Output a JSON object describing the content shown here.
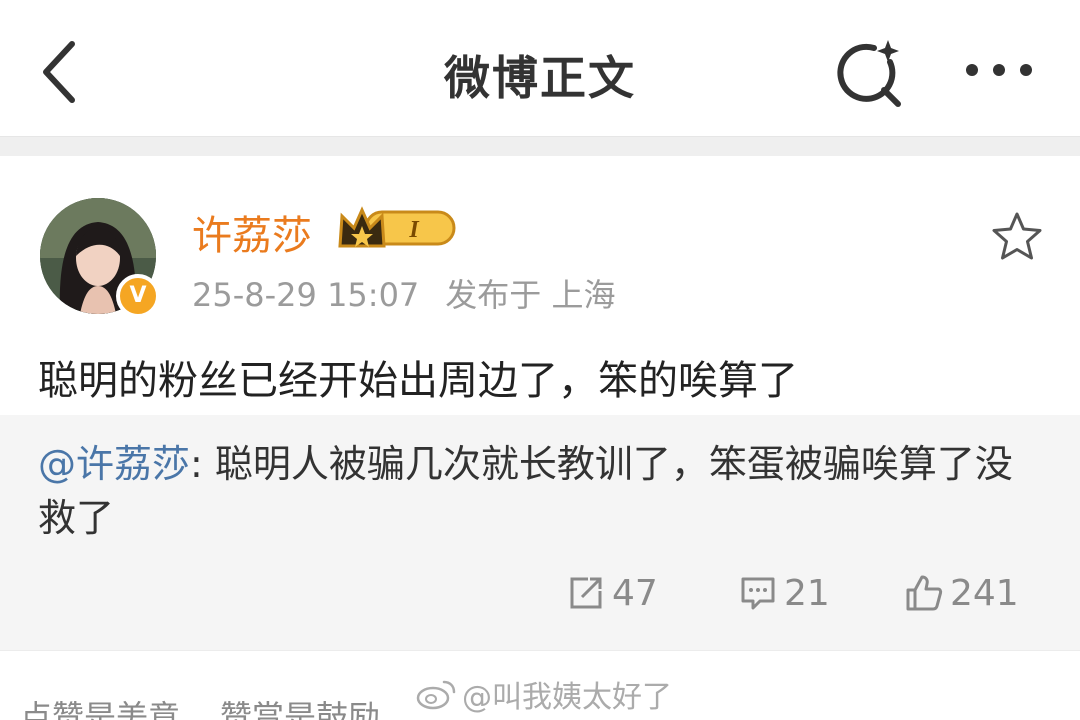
{
  "header": {
    "title": "微博正文",
    "back_icon": "chevron-left-icon",
    "search_icon": "search-sparkle-icon",
    "more_icon": "more-dots-icon"
  },
  "post": {
    "username": "许荔莎",
    "member_badge": "I",
    "verified_badge": "V",
    "timestamp": "25-8-29 15:07",
    "published_label": "发布于 上海",
    "text": "聪明的粉丝已经开始出周边了，笨的唉算了",
    "favorite_icon": "star-icon"
  },
  "retweet": {
    "mention": "@许荔莎",
    "separator": ": ",
    "text": "聪明人被骗几次就长教训了，笨蛋被骗唉算了没救了",
    "repost_count": "47",
    "comment_count": "21",
    "like_count": "241"
  },
  "footer": {
    "left_text": "点赞是美意",
    "right_text": "赞赏是鼓励",
    "watermark": "@叫我姨太好了"
  },
  "colors": {
    "username": "#ea7b1e",
    "mention": "#4a76a8",
    "meta": "#9b9b9b",
    "retweet_bg": "#f5f5f5"
  }
}
